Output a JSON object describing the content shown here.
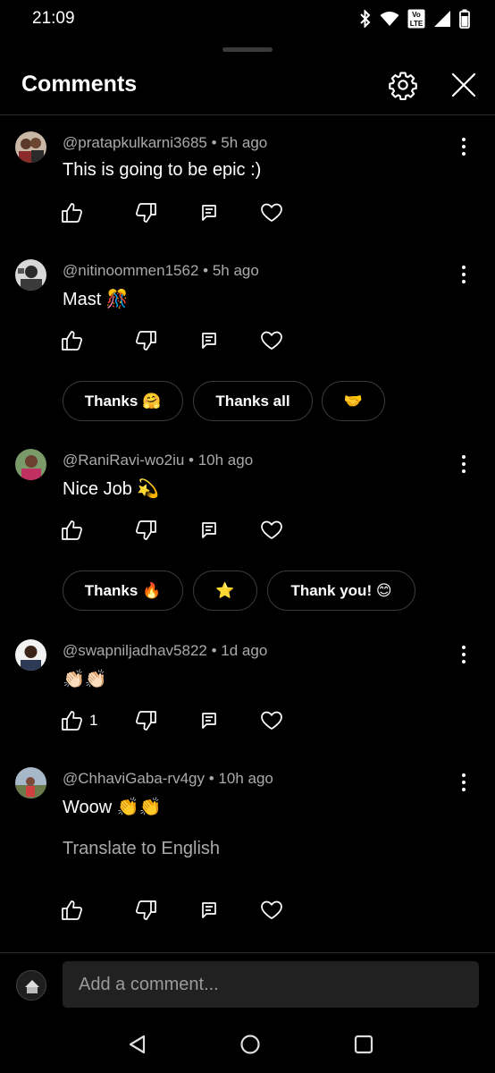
{
  "status_bar": {
    "time": "21:09",
    "icons": [
      "bluetooth-icon",
      "wifi-icon",
      "volte-icon",
      "signal-icon",
      "battery-icon"
    ],
    "volte_label": "Vo LTE"
  },
  "header": {
    "title": "Comments",
    "icons": [
      "gear-icon",
      "close-icon"
    ]
  },
  "comments": [
    {
      "author": "@pratapkulkarni3685",
      "age": "5h ago",
      "text": "This is going to be epic :)",
      "like_count": "",
      "translate": ""
    },
    {
      "author": "@nitinoommen1562",
      "age": "5h ago",
      "text": "Mast 🎊",
      "like_count": "",
      "translate": "",
      "quick_replies": [
        "Thanks 🤗",
        "Thanks all",
        "🤝"
      ]
    },
    {
      "author": "@RaniRavi-wo2iu",
      "age": "10h ago",
      "text": "Nice Job 💫",
      "like_count": "",
      "translate": "",
      "quick_replies": [
        "Thanks 🔥",
        "⭐",
        "Thank you! 😊"
      ]
    },
    {
      "author": "@swapniljadhav5822",
      "age": "1d ago",
      "text": "👏🏻👏🏻",
      "like_count": "1",
      "translate": ""
    },
    {
      "author": "@ChhaviGaba-rv4gy",
      "age": "10h ago",
      "text": "Woow 👏👏",
      "like_count": "",
      "translate": "Translate to English"
    }
  ],
  "composer": {
    "placeholder": "Add a comment..."
  },
  "nav_bar": [
    "back-icon",
    "home-icon",
    "recents-icon"
  ],
  "colors": {
    "background": "#000000",
    "text": "#ffffff",
    "secondary_text": "#aaaaaa",
    "divider": "#2b2b2b",
    "input_bg": "#212121"
  }
}
